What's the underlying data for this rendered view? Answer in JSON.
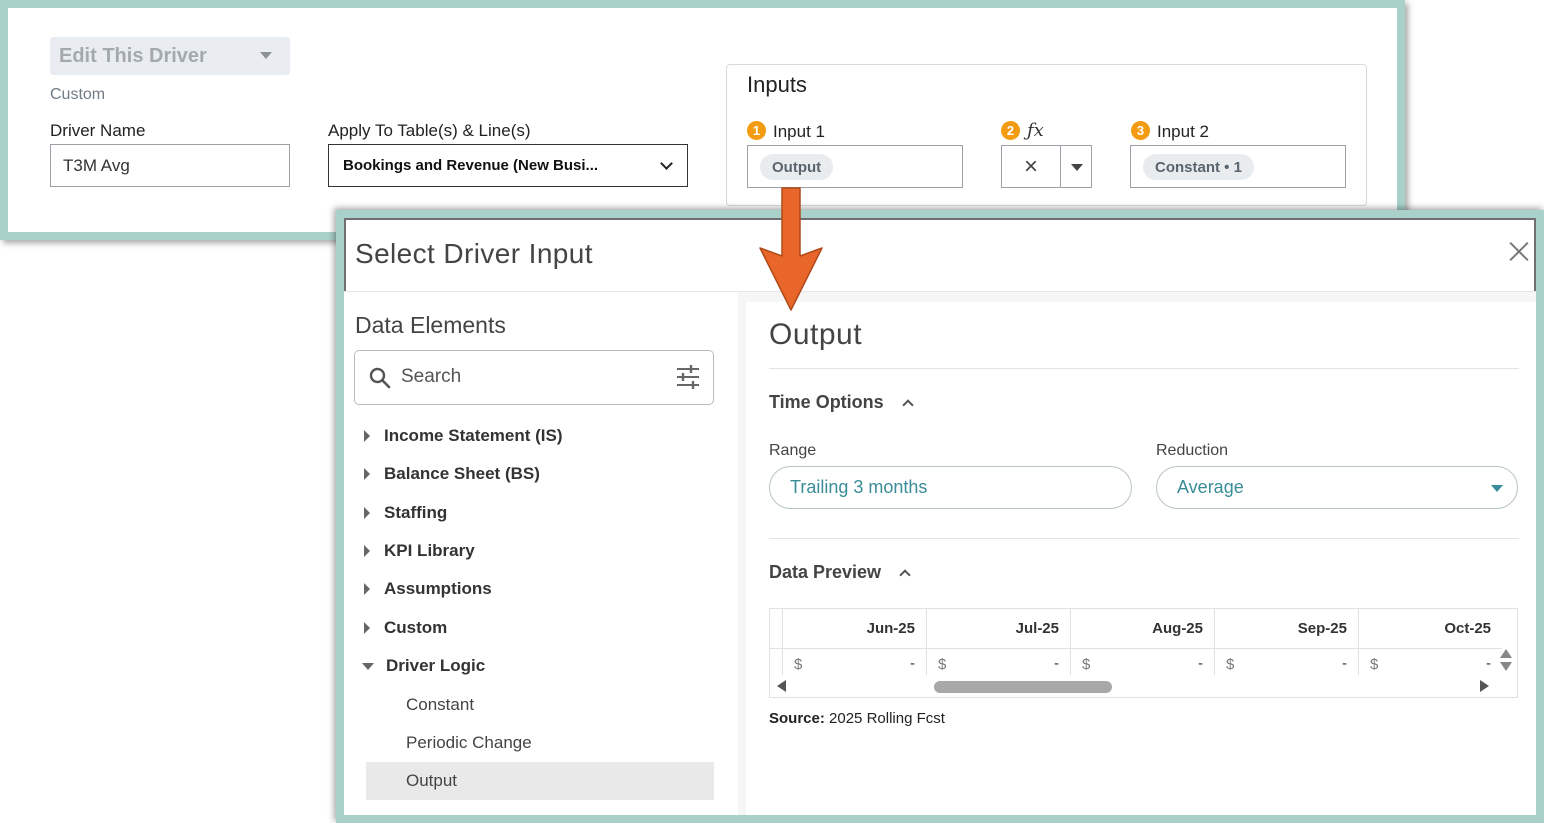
{
  "editor": {
    "driver_select": "Edit This Driver",
    "category": "Custom",
    "driver_name_label": "Driver Name",
    "driver_name_value": "T3M Avg",
    "apply_label": "Apply To Table(s) & Line(s)",
    "apply_value": "Bookings and Revenue (New Busi...",
    "inputs": {
      "title": "Inputs",
      "input1": {
        "badge": "1",
        "label": "Input 1",
        "chip": "Output"
      },
      "operator": {
        "badge": "2",
        "glyph": "ƒx",
        "value": "×"
      },
      "input2": {
        "badge": "3",
        "label": "Input 2",
        "chip": "Constant • 1"
      }
    }
  },
  "modal": {
    "title": "Select Driver Input",
    "data_elements": {
      "title": "Data Elements",
      "search_placeholder": "Search",
      "tree": [
        {
          "label": "Income Statement (IS)",
          "expanded": false
        },
        {
          "label": "Balance Sheet (BS)",
          "expanded": false
        },
        {
          "label": "Staffing",
          "expanded": false
        },
        {
          "label": "KPI Library",
          "expanded": false
        },
        {
          "label": "Assumptions",
          "expanded": false
        },
        {
          "label": "Custom",
          "expanded": false
        },
        {
          "label": "Driver Logic",
          "expanded": true
        }
      ],
      "driver_logic_children": [
        {
          "label": "Constant",
          "selected": false
        },
        {
          "label": "Periodic Change",
          "selected": false
        },
        {
          "label": "Output",
          "selected": true
        }
      ]
    },
    "detail": {
      "title": "Output",
      "time_options": {
        "title": "Time Options",
        "range_label": "Range",
        "range_value": "Trailing 3 months",
        "reduction_label": "Reduction",
        "reduction_value": "Average"
      },
      "data_preview": {
        "title": "Data Preview",
        "columns": [
          "Jun-25",
          "Jul-25",
          "Aug-25",
          "Sep-25",
          "Oct-25"
        ],
        "currency": "$",
        "cell_value": "-",
        "source_label": "Source:",
        "source_value": "2025 Rolling Fcst"
      }
    }
  },
  "colors": {
    "frame": "#a9d1c9",
    "badge": "#f39c12",
    "teal_text": "#3a8c98",
    "arrow": "#e8662a"
  }
}
